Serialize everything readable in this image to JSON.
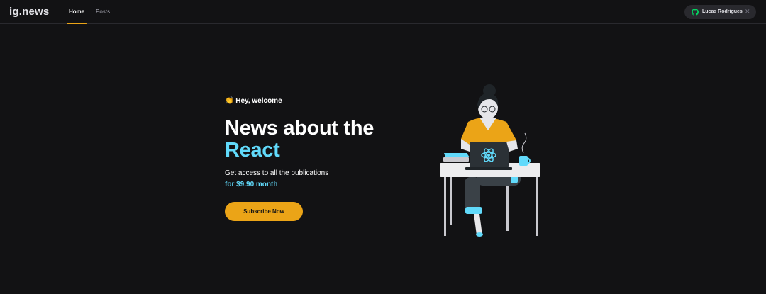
{
  "header": {
    "logo": "ig.news",
    "nav": [
      {
        "label": "Home",
        "active": true
      },
      {
        "label": "Posts",
        "active": false
      }
    ],
    "user": {
      "name": "Lucas Rodrigues",
      "icon": "github-icon",
      "close_icon": "close-icon"
    }
  },
  "hero": {
    "greeting_emoji": "👏",
    "greeting": "Hey, welcome",
    "title_line1": "News about the",
    "title_line2": "React",
    "subtitle": "Get access to all the publications",
    "price": "for $9.90 month",
    "cta_label": "Subscribe Now"
  },
  "illustration": {
    "icon": "woman-with-laptop-illustration"
  },
  "colors": {
    "background": "#121214",
    "accent": "#eba417",
    "react_blue": "#61dafb",
    "surface": "#29292e"
  }
}
